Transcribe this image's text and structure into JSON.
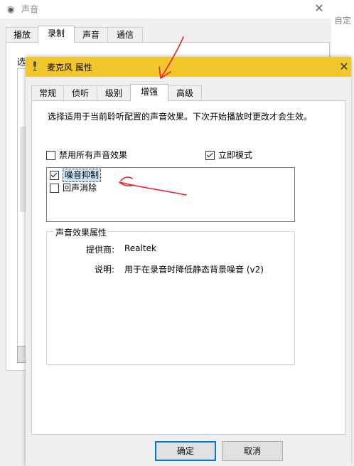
{
  "background_window": {
    "title": "声音",
    "tabs": [
      {
        "label": "播放",
        "active": false
      },
      {
        "label": "录制",
        "active": true
      },
      {
        "label": "声音",
        "active": false
      },
      {
        "label": "通信",
        "active": false
      }
    ],
    "choose_prefix": "选",
    "faded_side_text": "自定"
  },
  "dialog": {
    "title": "麦克风 属性",
    "title_color": "#f2c72c",
    "tabs": [
      {
        "label": "常规",
        "active": false
      },
      {
        "label": "侦听",
        "active": false
      },
      {
        "label": "级别",
        "active": false
      },
      {
        "label": "增强",
        "active": true
      },
      {
        "label": "高级",
        "active": false
      }
    ],
    "description": "选择适用于当前聆听配置的声音效果。下次开始播放时更改才会生效。",
    "disable_all_effects": {
      "label": "禁用所有声音效果",
      "checked": false
    },
    "immediate_mode": {
      "label": "立即模式",
      "checked": true
    },
    "effects": [
      {
        "label": "噪音抑制",
        "checked": true,
        "selected": true
      },
      {
        "label": "回声消除",
        "checked": false,
        "selected": false
      }
    ],
    "properties_group": {
      "title": "声音效果属性",
      "provider_label": "提供商:",
      "provider_value": "Realtek",
      "description_label": "说明:",
      "description_value": "用于在录音时降低静态背景噪音 (v2)"
    },
    "buttons": {
      "ok": "确定",
      "cancel": "取消"
    }
  },
  "annotation_color": "#e8232a"
}
